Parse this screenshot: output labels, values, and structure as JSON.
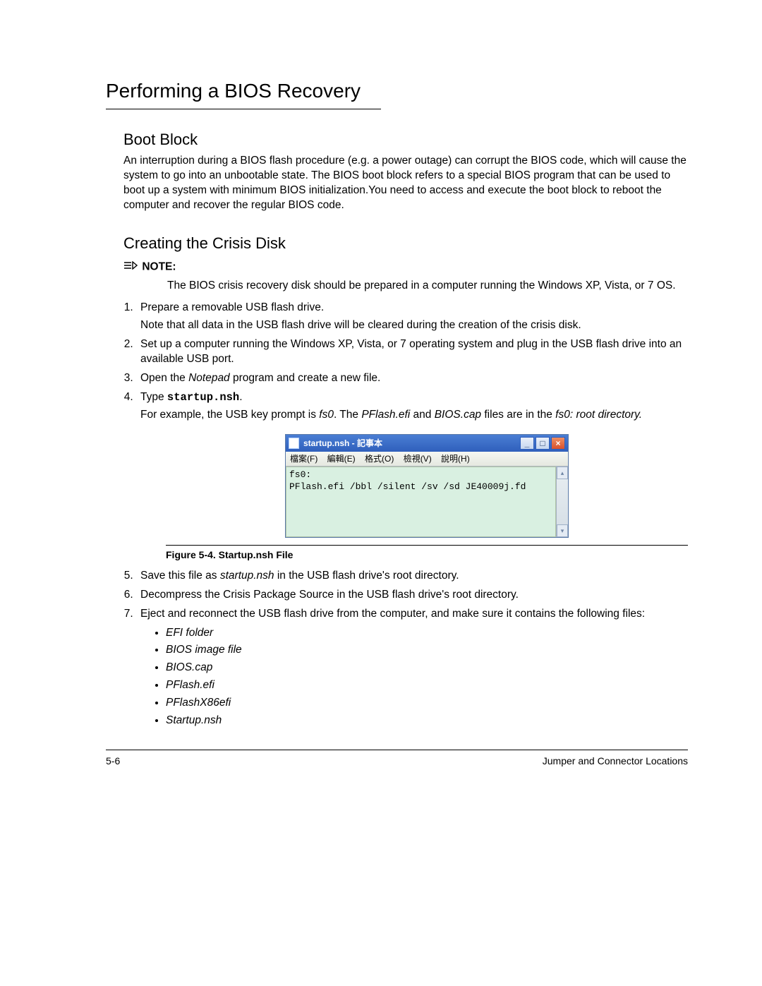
{
  "title": "Performing a BIOS Recovery",
  "section_boot": {
    "heading": "Boot Block",
    "body": "An interruption during a BIOS flash procedure (e.g. a power outage) can corrupt the BIOS code, which will cause the system to go into an unbootable state. The BIOS boot block refers to a special BIOS program that can be used to boot up a system with minimum BIOS initialization.You need to access and execute the boot block to reboot the computer and recover the regular BIOS code."
  },
  "section_crisis": {
    "heading": "Creating the Crisis Disk",
    "note_label": "NOTE:",
    "note_body": "The BIOS crisis recovery disk should be prepared in a computer running the Windows XP, Vista, or 7 OS.",
    "steps": [
      {
        "main": "Prepare a removable USB flash drive.",
        "extra": "Note that all data in the USB flash drive will be cleared during the creation of the crisis disk."
      },
      {
        "main": "Set up a computer running the Windows XP, Vista, or 7 operating system and plug in the USB flash drive into an available USB port."
      },
      {
        "main_parts": [
          "Open the ",
          "Notepad",
          " program and create a new file."
        ]
      },
      {
        "type_prefix": "Type ",
        "type_cmd": "startup.nsh",
        "type_suffix": ".",
        "example_parts": [
          "For example, the USB key prompt is ",
          "fs0",
          ". The ",
          "PFlash.efi",
          " and ",
          "BIOS.cap",
          " files are in the ",
          "fs0: root directory."
        ]
      }
    ],
    "notepad": {
      "title": "startup.nsh - 記事本",
      "menus": [
        "檔案(F)",
        "編輯(E)",
        "格式(O)",
        "檢視(V)",
        "說明(H)"
      ],
      "line1": "fs0:",
      "line2": "PFlash.efi /bbl /silent /sv /sd JE40009j.fd"
    },
    "figure_caption": "Figure 5-4.   Startup.nsh File",
    "steps2": [
      {
        "parts": [
          "Save this file as ",
          "startup.nsh",
          " in the USB flash drive's root directory."
        ]
      },
      {
        "plain": "Decompress the Crisis Package Source in the USB flash drive's root directory."
      },
      {
        "plain": "Eject and reconnect the USB flash drive from the computer, and make sure it contains the following files:"
      }
    ],
    "files": [
      "EFI folder",
      "BIOS image file",
      "BIOS.cap",
      "PFlash.efi",
      "PFlashX86efi",
      "Startup.nsh"
    ]
  },
  "footer": {
    "left": "5-6",
    "right": "Jumper and Connector Locations"
  }
}
